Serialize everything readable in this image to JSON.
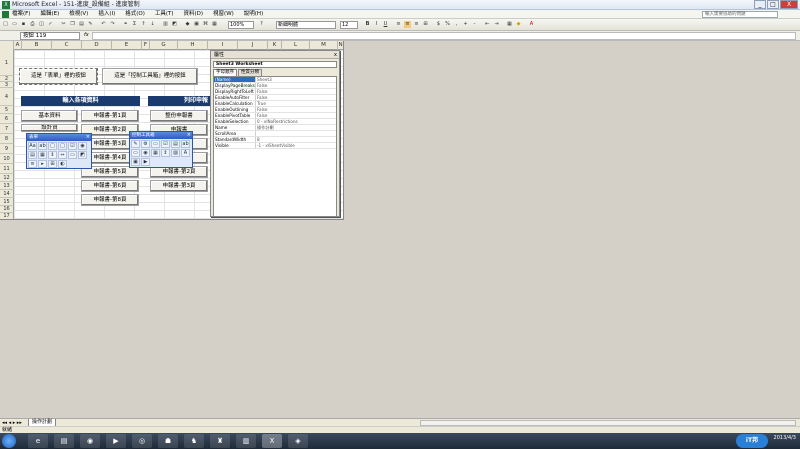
{
  "window": {
    "title": "Microsoft Excel - 151-進度_設備組 - 進度管制",
    "minimize": "_",
    "maximize": "□",
    "close": "X"
  },
  "menu": [
    "檔案(F)",
    "編輯(E)",
    "檢視(V)",
    "插入(I)",
    "格式(O)",
    "工具(T)",
    "資料(D)",
    "視窗(W)",
    "說明(H)"
  ],
  "help_placeholder": "輸入需要協助的問題",
  "toolbar": {
    "zoom": "100%",
    "font": "新細明體",
    "size": "12",
    "bold": "B",
    "italic": "I",
    "underline": "U"
  },
  "namebox": "按鈕 119",
  "fx": "fx",
  "columns": [
    "A",
    "B",
    "C",
    "D",
    "E",
    "F",
    "G",
    "H",
    "I",
    "J",
    "K",
    "L",
    "M",
    "N"
  ],
  "rows": [
    "1",
    "2",
    "3",
    "4",
    "5",
    "6",
    "7",
    "8",
    "9",
    "10",
    "11",
    "12",
    "13",
    "14",
    "15",
    "16",
    "17"
  ],
  "sheet": {
    "form_button": "這是「表單」裡的按鈕",
    "control_button": "這是「控制工具箱」裡的按鈕",
    "left_header": "輸入各項資料",
    "right_header": "列印申報",
    "left_buttons": [
      "基本資料",
      "設計資"
    ],
    "mid_buttons": [
      "申報書-第1頁",
      "申報書-第2頁",
      "申報書-第3頁",
      "申報書-第4頁",
      "申報書-第5頁",
      "申報書-第6頁",
      "申報書-第8頁"
    ],
    "right_buttons": [
      "整份申報書",
      "申報書",
      "申報書",
      "申報書",
      "申報書-第2頁",
      "申報書-第3頁"
    ]
  },
  "forms_palette": {
    "title": "表單",
    "close": "×",
    "icons": [
      "Aa",
      "ab",
      "□",
      "□",
      "☑",
      "◉",
      "▤",
      "▦",
      "⇕",
      "⇔",
      "▭",
      "◩",
      "≡",
      "▸",
      "⊞",
      "◐"
    ]
  },
  "control_palette": {
    "title": "控制工具箱",
    "close": "×",
    "icons": [
      "✎",
      "⚙",
      "▭",
      "☑",
      "▤",
      "ab",
      "▭",
      "◉",
      "▦",
      "⇕",
      "▨",
      "A",
      "▣",
      "▶"
    ]
  },
  "properties": {
    "title": "屬性",
    "close": "x",
    "object": "Sheet3 Worksheet",
    "tabs": [
      "字母順序",
      "性質分類"
    ],
    "rows": [
      {
        "k": "(Name)",
        "v": "Sheet3"
      },
      {
        "k": "DisplayPageBreaks",
        "v": "False"
      },
      {
        "k": "DisplayRightToLeft",
        "v": "False"
      },
      {
        "k": "EnableAutoFilter",
        "v": "False"
      },
      {
        "k": "EnableCalculation",
        "v": "True"
      },
      {
        "k": "EnableOutlining",
        "v": "False"
      },
      {
        "k": "EnablePivotTable",
        "v": "False"
      },
      {
        "k": "EnableSelection",
        "v": "0 - xlNoRestrictions"
      },
      {
        "k": "Name",
        "v": "操作計劃"
      },
      {
        "k": "ScrollArea",
        "v": ""
      },
      {
        "k": "StandardWidth",
        "v": "8"
      },
      {
        "k": "Visible",
        "v": "-1 - xlSheetVisible"
      }
    ]
  },
  "sheet_nav": "◂◂ ◂ ▸ ▸▸",
  "sheet_tab": "操作計劃",
  "status": "就緒",
  "tray": {
    "logo": "iT邦",
    "date": "2013/4/3"
  }
}
